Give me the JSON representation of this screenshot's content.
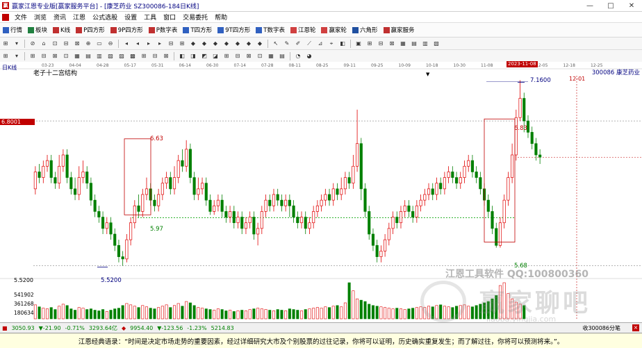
{
  "window": {
    "title": "赢家江恩专业版[赢家服务平台] - [康芝药业  SZ300086-184日K线]",
    "controls": [
      "—",
      "□",
      "✕"
    ]
  },
  "menu": [
    "文件",
    "浏览",
    "资讯",
    "江恩",
    "公式选股",
    "设置",
    "工具",
    "窗口",
    "交易委托",
    "帮助"
  ],
  "toolbar1": [
    {
      "label": "行情",
      "icon": "grid-icon",
      "color": "#3060c0"
    },
    {
      "label": "板块",
      "icon": "blocks-icon",
      "color": "#208040"
    },
    {
      "label": "K线",
      "icon": "k-icon",
      "color": "#c03030"
    },
    {
      "label": "P四方形",
      "icon": "p-square-icon",
      "color": "#c03030"
    },
    {
      "label": "9P四方形",
      "icon": "9p-square-icon",
      "color": "#c03030"
    },
    {
      "label": "P数字表",
      "icon": "p-table-icon",
      "color": "#c03030"
    },
    {
      "label": "T四方形",
      "icon": "t-square-icon",
      "color": "#3060c0"
    },
    {
      "label": "9T四方形",
      "icon": "9t-square-icon",
      "color": "#3060c0"
    },
    {
      "label": "T数字表",
      "icon": "t-table-icon",
      "color": "#3060c0"
    },
    {
      "label": "江恩轮",
      "icon": "gann-wheel-icon",
      "color": "#d04040"
    },
    {
      "label": "赢家轮",
      "icon": "winner-wheel-icon",
      "color": "#d04040"
    },
    {
      "label": "六角形",
      "icon": "hexagon-icon",
      "color": "#2050a0"
    },
    {
      "label": "赢家服务",
      "icon": "service-icon",
      "color": "#c03030"
    }
  ],
  "chart": {
    "period_label": "日K线",
    "stock_label": "300086  康芝药业",
    "indicator_label": "老子十二宫结构",
    "highlight_date": "2023-11-08",
    "future_date": "12-01",
    "price_axis_tag": "6.8001",
    "bottom_price_label": "5.5200",
    "volume_labels": [
      "541902",
      "361268",
      "180634"
    ],
    "date_ticks": [
      "03-23",
      "04-04",
      "04-28",
      "05-17",
      "05-31",
      "06-14",
      "06-30",
      "07-14",
      "07-28",
      "08-11",
      "08-25",
      "09-11",
      "09-25",
      "10-09",
      "10-18",
      "10-30",
      "11-08",
      "11-22",
      "12-05",
      "12-18",
      "12-25"
    ],
    "annotations": {
      "p_high": "7.1600",
      "p_663": "6.63",
      "p_597": "5.97",
      "p_552": "5.5200",
      "p_683": "6.83",
      "p_568": "5.68"
    },
    "watermark_1": "江恩工具软件  QQ:100800360",
    "watermark_2": "赢家聊吧",
    "watermark_url": "liaoba.yingjia.com"
  },
  "chart_data": {
    "type": "candlestick",
    "ylim": [
      5.45,
      7.2
    ],
    "candles": [
      {
        "o": 6.2,
        "c": 6.35,
        "h": 6.4,
        "l": 6.15
      },
      {
        "o": 6.35,
        "c": 6.3,
        "h": 6.42,
        "l": 6.25
      },
      {
        "o": 6.3,
        "c": 6.4,
        "h": 6.45,
        "l": 6.25
      },
      {
        "o": 6.4,
        "c": 6.45,
        "h": 6.5,
        "l": 6.35
      },
      {
        "o": 6.45,
        "c": 6.3,
        "h": 6.5,
        "l": 6.25
      },
      {
        "o": 6.3,
        "c": 6.25,
        "h": 6.35,
        "l": 6.2
      },
      {
        "o": 6.25,
        "c": 6.4,
        "h": 6.5,
        "l": 6.2
      },
      {
        "o": 6.4,
        "c": 6.5,
        "h": 6.55,
        "l": 6.35
      },
      {
        "o": 6.5,
        "c": 6.3,
        "h": 6.55,
        "l": 6.25
      },
      {
        "o": 6.3,
        "c": 6.2,
        "h": 6.35,
        "l": 6.15
      },
      {
        "o": 6.2,
        "c": 6.15,
        "h": 6.3,
        "l": 6.1
      },
      {
        "o": 6.15,
        "c": 6.3,
        "h": 6.4,
        "l": 6.1
      },
      {
        "o": 6.3,
        "c": 6.35,
        "h": 6.45,
        "l": 6.25
      },
      {
        "o": 6.35,
        "c": 6.25,
        "h": 6.4,
        "l": 6.2
      },
      {
        "o": 6.25,
        "c": 6.1,
        "h": 6.3,
        "l": 6.05
      },
      {
        "o": 6.1,
        "c": 6.0,
        "h": 6.15,
        "l": 5.95
      },
      {
        "o": 6.0,
        "c": 5.95,
        "h": 6.05,
        "l": 5.9
      },
      {
        "o": 5.95,
        "c": 5.85,
        "h": 6.0,
        "l": 5.8
      },
      {
        "o": 5.85,
        "c": 5.9,
        "h": 5.95,
        "l": 5.8
      },
      {
        "o": 5.9,
        "c": 5.8,
        "h": 5.95,
        "l": 5.75
      },
      {
        "o": 5.8,
        "c": 5.7,
        "h": 5.85,
        "l": 5.65
      },
      {
        "o": 5.7,
        "c": 5.6,
        "h": 5.75,
        "l": 5.55
      },
      {
        "o": 5.6,
        "c": 5.58,
        "h": 5.65,
        "l": 5.52
      },
      {
        "o": 5.58,
        "c": 5.75,
        "h": 5.8,
        "l": 5.55
      },
      {
        "o": 5.75,
        "c": 5.9,
        "h": 5.95,
        "l": 5.7
      },
      {
        "o": 5.9,
        "c": 6.05,
        "h": 6.1,
        "l": 5.85
      },
      {
        "o": 6.05,
        "c": 6.0,
        "h": 6.15,
        "l": 5.95
      },
      {
        "o": 6.0,
        "c": 6.15,
        "h": 6.2,
        "l": 5.95
      },
      {
        "o": 6.15,
        "c": 6.2,
        "h": 6.3,
        "l": 6.1
      },
      {
        "o": 6.2,
        "c": 6.1,
        "h": 6.25,
        "l": 6.05
      },
      {
        "o": 6.1,
        "c": 6.05,
        "h": 6.15,
        "l": 6.0
      },
      {
        "o": 6.05,
        "c": 6.15,
        "h": 6.2,
        "l": 6.0
      },
      {
        "o": 6.15,
        "c": 6.25,
        "h": 6.3,
        "l": 6.1
      },
      {
        "o": 6.25,
        "c": 6.3,
        "h": 6.35,
        "l": 6.2
      },
      {
        "o": 6.3,
        "c": 6.2,
        "h": 6.35,
        "l": 6.15
      },
      {
        "o": 6.2,
        "c": 6.3,
        "h": 6.4,
        "l": 6.15
      },
      {
        "o": 6.3,
        "c": 6.45,
        "h": 6.5,
        "l": 6.25
      },
      {
        "o": 6.45,
        "c": 6.4,
        "h": 6.55,
        "l": 6.35
      },
      {
        "o": 6.4,
        "c": 6.55,
        "h": 6.63,
        "l": 6.35
      },
      {
        "o": 6.55,
        "c": 6.3,
        "h": 6.6,
        "l": 6.25
      },
      {
        "o": 6.3,
        "c": 6.15,
        "h": 6.35,
        "l": 6.1
      },
      {
        "o": 6.15,
        "c": 6.2,
        "h": 6.3,
        "l": 6.1
      },
      {
        "o": 6.2,
        "c": 6.25,
        "h": 6.3,
        "l": 6.15
      },
      {
        "o": 6.25,
        "c": 6.1,
        "h": 6.3,
        "l": 6.05
      },
      {
        "o": 6.1,
        "c": 6.0,
        "h": 6.15,
        "l": 5.97
      },
      {
        "o": 6.0,
        "c": 6.05,
        "h": 6.1,
        "l": 5.97
      },
      {
        "o": 6.05,
        "c": 6.1,
        "h": 6.15,
        "l": 6.0
      },
      {
        "o": 6.1,
        "c": 6.0,
        "h": 6.15,
        "l": 5.95
      },
      {
        "o": 6.0,
        "c": 5.95,
        "h": 6.05,
        "l": 5.9
      },
      {
        "o": 5.95,
        "c": 6.0,
        "h": 6.05,
        "l": 5.9
      },
      {
        "o": 6.0,
        "c": 5.9,
        "h": 6.05,
        "l": 5.85
      },
      {
        "o": 5.9,
        "c": 5.95,
        "h": 6.0,
        "l": 5.85
      },
      {
        "o": 5.95,
        "c": 5.85,
        "h": 6.0,
        "l": 5.8
      },
      {
        "o": 5.85,
        "c": 5.9,
        "h": 5.95,
        "l": 5.8
      },
      {
        "o": 5.9,
        "c": 5.95,
        "h": 6.0,
        "l": 5.85
      },
      {
        "o": 5.95,
        "c": 5.8,
        "h": 6.0,
        "l": 5.75
      },
      {
        "o": 5.8,
        "c": 5.85,
        "h": 5.9,
        "l": 5.7
      },
      {
        "o": 5.85,
        "c": 6.0,
        "h": 6.05,
        "l": 5.8
      },
      {
        "o": 6.0,
        "c": 6.1,
        "h": 6.15,
        "l": 5.95
      },
      {
        "o": 6.1,
        "c": 6.05,
        "h": 6.15,
        "l": 6.0
      },
      {
        "o": 6.05,
        "c": 6.15,
        "h": 6.2,
        "l": 6.0
      },
      {
        "o": 6.15,
        "c": 6.1,
        "h": 6.2,
        "l": 6.05
      },
      {
        "o": 6.1,
        "c": 6.05,
        "h": 6.15,
        "l": 6.0
      },
      {
        "o": 6.05,
        "c": 6.1,
        "h": 6.15,
        "l": 6.0
      },
      {
        "o": 6.1,
        "c": 6.05,
        "h": 6.15,
        "l": 5.95
      },
      {
        "o": 6.05,
        "c": 5.95,
        "h": 6.1,
        "l": 5.9
      },
      {
        "o": 5.95,
        "c": 5.9,
        "h": 6.0,
        "l": 5.85
      },
      {
        "o": 5.9,
        "c": 5.95,
        "h": 6.0,
        "l": 5.85
      },
      {
        "o": 5.95,
        "c": 5.85,
        "h": 6.0,
        "l": 5.8
      },
      {
        "o": 5.85,
        "c": 5.9,
        "h": 5.95,
        "l": 5.8
      },
      {
        "o": 5.9,
        "c": 6.0,
        "h": 6.05,
        "l": 5.85
      },
      {
        "o": 6.0,
        "c": 6.05,
        "h": 6.1,
        "l": 5.95
      },
      {
        "o": 6.05,
        "c": 6.1,
        "h": 6.15,
        "l": 6.0
      },
      {
        "o": 6.1,
        "c": 6.15,
        "h": 6.2,
        "l": 6.05
      },
      {
        "o": 6.15,
        "c": 6.1,
        "h": 6.2,
        "l": 6.05
      },
      {
        "o": 6.1,
        "c": 6.2,
        "h": 6.25,
        "l": 6.05
      },
      {
        "o": 6.2,
        "c": 6.15,
        "h": 6.25,
        "l": 6.1
      },
      {
        "o": 6.15,
        "c": 6.2,
        "h": 6.3,
        "l": 6.1
      },
      {
        "o": 6.2,
        "c": 6.3,
        "h": 6.35,
        "l": 6.15
      },
      {
        "o": 6.3,
        "c": 6.25,
        "h": 6.35,
        "l": 6.2
      },
      {
        "o": 6.25,
        "c": 6.4,
        "h": 6.5,
        "l": 6.2
      },
      {
        "o": 6.4,
        "c": 6.6,
        "h": 6.9,
        "l": 6.35
      },
      {
        "o": 6.6,
        "c": 6.2,
        "h": 6.65,
        "l": 6.1
      },
      {
        "o": 6.2,
        "c": 6.0,
        "h": 6.25,
        "l": 5.95
      },
      {
        "o": 6.0,
        "c": 5.8,
        "h": 6.05,
        "l": 5.75
      },
      {
        "o": 5.8,
        "c": 5.7,
        "h": 5.85,
        "l": 5.65
      },
      {
        "o": 5.7,
        "c": 5.6,
        "h": 5.75,
        "l": 5.55
      },
      {
        "o": 5.6,
        "c": 5.65,
        "h": 5.7,
        "l": 5.55
      },
      {
        "o": 5.65,
        "c": 5.75,
        "h": 5.8,
        "l": 5.6
      },
      {
        "o": 5.75,
        "c": 5.85,
        "h": 5.9,
        "l": 5.7
      },
      {
        "o": 5.85,
        "c": 5.95,
        "h": 6.0,
        "l": 5.8
      },
      {
        "o": 5.95,
        "c": 5.9,
        "h": 6.0,
        "l": 5.85
      },
      {
        "o": 5.9,
        "c": 6.0,
        "h": 6.05,
        "l": 5.85
      },
      {
        "o": 6.0,
        "c": 6.05,
        "h": 6.1,
        "l": 5.95
      },
      {
        "o": 6.05,
        "c": 6.0,
        "h": 6.1,
        "l": 5.95
      },
      {
        "o": 6.0,
        "c": 5.95,
        "h": 6.05,
        "l": 5.9
      },
      {
        "o": 5.95,
        "c": 6.05,
        "h": 6.1,
        "l": 5.9
      },
      {
        "o": 6.05,
        "c": 6.1,
        "h": 6.15,
        "l": 6.0
      },
      {
        "o": 6.1,
        "c": 6.15,
        "h": 6.2,
        "l": 6.05
      },
      {
        "o": 6.15,
        "c": 6.2,
        "h": 6.25,
        "l": 6.1
      },
      {
        "o": 6.2,
        "c": 6.15,
        "h": 6.25,
        "l": 6.1
      },
      {
        "o": 6.15,
        "c": 6.25,
        "h": 6.3,
        "l": 6.1
      },
      {
        "o": 6.25,
        "c": 6.2,
        "h": 6.3,
        "l": 6.15
      },
      {
        "o": 6.2,
        "c": 6.3,
        "h": 6.35,
        "l": 6.15
      },
      {
        "o": 6.3,
        "c": 6.35,
        "h": 6.4,
        "l": 6.25
      },
      {
        "o": 6.35,
        "c": 6.3,
        "h": 6.4,
        "l": 6.25
      },
      {
        "o": 6.3,
        "c": 6.25,
        "h": 6.35,
        "l": 6.2
      },
      {
        "o": 6.25,
        "c": 6.3,
        "h": 6.35,
        "l": 6.2
      },
      {
        "o": 6.3,
        "c": 6.4,
        "h": 6.45,
        "l": 6.25
      },
      {
        "o": 6.4,
        "c": 6.45,
        "h": 6.5,
        "l": 6.35
      },
      {
        "o": 6.45,
        "c": 6.35,
        "h": 6.5,
        "l": 6.3
      },
      {
        "o": 6.35,
        "c": 6.3,
        "h": 6.4,
        "l": 6.25
      },
      {
        "o": 6.3,
        "c": 6.2,
        "h": 6.35,
        "l": 6.15
      },
      {
        "o": 6.2,
        "c": 6.1,
        "h": 6.25,
        "l": 6.05
      },
      {
        "o": 6.1,
        "c": 6.0,
        "h": 6.15,
        "l": 5.95
      },
      {
        "o": 6.0,
        "c": 5.85,
        "h": 6.05,
        "l": 5.8
      },
      {
        "o": 5.85,
        "c": 5.7,
        "h": 5.9,
        "l": 5.68
      },
      {
        "o": 5.7,
        "c": 5.9,
        "h": 5.95,
        "l": 5.68
      },
      {
        "o": 5.9,
        "c": 6.1,
        "h": 6.15,
        "l": 5.85
      },
      {
        "o": 6.1,
        "c": 6.3,
        "h": 6.35,
        "l": 6.05
      },
      {
        "o": 6.3,
        "c": 6.5,
        "h": 6.6,
        "l": 6.25
      },
      {
        "o": 6.5,
        "c": 6.83,
        "h": 6.9,
        "l": 6.45
      },
      {
        "o": 6.83,
        "c": 7.0,
        "h": 7.16,
        "l": 6.8
      },
      {
        "o": 7.0,
        "c": 6.8,
        "h": 7.05,
        "l": 6.7
      },
      {
        "o": 6.8,
        "c": 6.7,
        "h": 6.85,
        "l": 6.65
      },
      {
        "o": 6.7,
        "c": 6.6,
        "h": 6.75,
        "l": 6.55
      },
      {
        "o": 6.6,
        "c": 6.5,
        "h": 6.65,
        "l": 6.45
      },
      {
        "o": 6.5,
        "c": 6.48,
        "h": 6.55,
        "l": 6.42
      }
    ],
    "volume": [
      210000,
      180000,
      160000,
      150000,
      170000,
      140000,
      190000,
      220000,
      200000,
      150000,
      130000,
      170000,
      160000,
      140000,
      150000,
      130000,
      120000,
      140000,
      110000,
      130000,
      150000,
      160000,
      200000,
      230000,
      210000,
      190000,
      170000,
      200000,
      180000,
      160000,
      150000,
      170000,
      190000,
      210000,
      170000,
      200000,
      230000,
      190000,
      260000,
      240000,
      200000,
      170000,
      160000,
      150000,
      140000,
      130000,
      150000,
      140000,
      120000,
      130000,
      110000,
      120000,
      130000,
      120000,
      140000,
      150000,
      160000,
      150000,
      140000,
      130000,
      120000,
      140000,
      130000,
      120000,
      150000,
      140000,
      130000,
      120000,
      140000,
      150000,
      160000,
      170000,
      160000,
      180000,
      170000,
      190000,
      200000,
      180000,
      240000,
      541902,
      420000,
      300000,
      280000,
      260000,
      220000,
      200000,
      190000,
      180000,
      170000,
      160000,
      150000,
      160000,
      150000,
      140000,
      150000,
      160000,
      170000,
      180000,
      170000,
      190000,
      180000,
      200000,
      210000,
      190000,
      180000,
      170000,
      190000,
      200000,
      210000,
      190000,
      180000,
      200000,
      220000,
      240000,
      260000,
      300000,
      350000,
      500000,
      541902,
      380000,
      300000,
      250000,
      220000,
      200000
    ],
    "horizontal_lines": [
      {
        "price": 6.8001,
        "label": "6.8001"
      },
      {
        "price": 5.97,
        "label": "5.97"
      },
      {
        "price": 5.52,
        "label": "5.5200"
      }
    ]
  },
  "status": {
    "sh_index": "3050.93",
    "sh_change": "▼-21.90",
    "sh_pct": "-0.71%",
    "sh_amount": "3293.64亿",
    "sz_index": "9954.40",
    "sz_change": "▼-123.56",
    "sz_pct": "-1.23%",
    "sz_amount": "5214.83",
    "right_text": "收300086分笔"
  },
  "quote": "江恩经典语录：“时间是决定市场走势的重要因素，经过详细研究大市及个别股票的过往记录，你将可以证明，历史确实重复发生；而了解过往，你将可以预测将来。”。",
  "colors": {
    "up": "#e00000",
    "down": "#008000",
    "title_text": "#000080",
    "box": "#c00000",
    "dashed_green": "#00a000"
  }
}
